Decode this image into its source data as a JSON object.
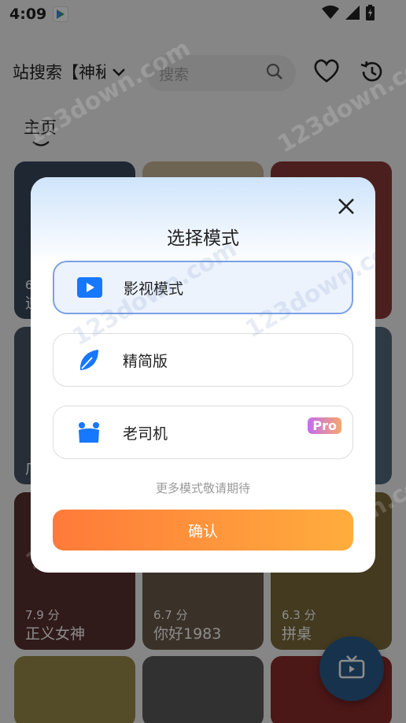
{
  "status_bar": {
    "time": "4:09"
  },
  "top_bar": {
    "source_label": "站搜索【神秘",
    "search_placeholder": "搜索"
  },
  "nav": {
    "home_tab": "主页"
  },
  "posters": [
    {
      "rating": "6",
      "title": "逆",
      "color": "#3a4a5c"
    },
    {
      "rating": "",
      "title": "",
      "color": "#c8b69a"
    },
    {
      "rating": "",
      "title": "",
      "color": "#8a3a3a"
    },
    {
      "rating": "",
      "title": "广",
      "color": "#4a5566"
    },
    {
      "rating": "",
      "title": "",
      "color": "#6a6a6a"
    },
    {
      "rating": "",
      "title": "",
      "color": "#556a7a"
    },
    {
      "rating": "7.9 分",
      "title": "正义女神",
      "color": "#5a3030"
    },
    {
      "rating": "6.7 分",
      "title": "你好1983",
      "color": "#6a5a4a"
    },
    {
      "rating": "6.3 分",
      "title": "拼桌",
      "color": "#7a6a3a"
    },
    {
      "rating": "",
      "title": "",
      "color": "#9a8a4a"
    },
    {
      "rating": "",
      "title": "",
      "color": "#5a5a5a"
    },
    {
      "rating": "",
      "title": "",
      "color": "#8a2a2a"
    }
  ],
  "dialog": {
    "title": "选择模式",
    "modes": [
      {
        "label": "影视模式",
        "selected": true,
        "icon": "play-icon"
      },
      {
        "label": "精简版",
        "selected": false,
        "icon": "leaf-icon"
      },
      {
        "label": "老司机",
        "selected": false,
        "icon": "figure-icon",
        "badge": "Pro"
      }
    ],
    "more_text": "更多模式敬请期待",
    "confirm_label": "确认"
  },
  "watermark": "123down.com",
  "colors": {
    "accent_blue": "#1677ff",
    "confirm_start": "#ff7a3a",
    "confirm_end": "#ffad3d",
    "selected_border": "#7aa0e6"
  }
}
